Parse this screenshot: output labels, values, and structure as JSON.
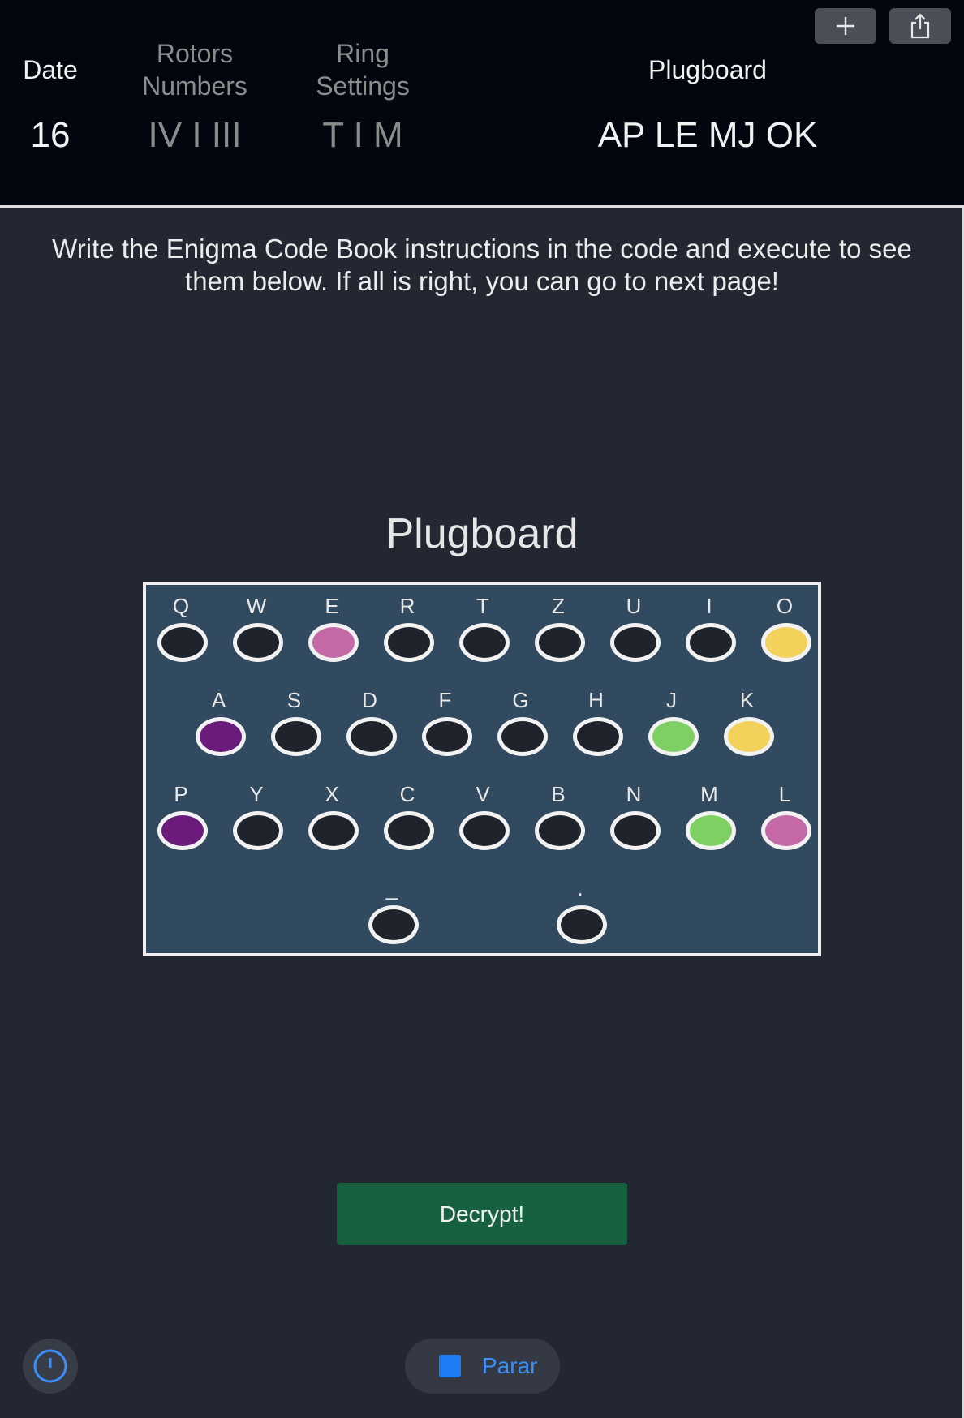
{
  "header": {
    "date_label": "Date",
    "rotors_label_line1": "Rotors",
    "rotors_label_line2": "Numbers",
    "ring_label_line1": "Ring",
    "ring_label_line2": "Settings",
    "plugboard_label": "Plugboard",
    "date_value": "16",
    "rotors_value": "IV I III",
    "ring_value": "T I M",
    "plugboard_value": "AP LE MJ OK"
  },
  "toolbar": {
    "add_icon": "plus-icon",
    "share_icon": "share-icon"
  },
  "instructions": "Write the Enigma Code Book instructions in the code and execute to see them below. If all is right, you can go to next page!",
  "plugboard": {
    "title": "Plugboard",
    "rows": [
      [
        {
          "letter": "Q",
          "color": "#1f232c"
        },
        {
          "letter": "W",
          "color": "#1f232c"
        },
        {
          "letter": "E",
          "color": "#c568a6"
        },
        {
          "letter": "R",
          "color": "#1f232c"
        },
        {
          "letter": "T",
          "color": "#1f232c"
        },
        {
          "letter": "Z",
          "color": "#1f232c"
        },
        {
          "letter": "U",
          "color": "#1f232c"
        },
        {
          "letter": "I",
          "color": "#1f232c"
        },
        {
          "letter": "O",
          "color": "#f3d25c"
        }
      ],
      [
        {
          "letter": "A",
          "color": "#6b1b7c"
        },
        {
          "letter": "S",
          "color": "#1f232c"
        },
        {
          "letter": "D",
          "color": "#1f232c"
        },
        {
          "letter": "F",
          "color": "#1f232c"
        },
        {
          "letter": "G",
          "color": "#1f232c"
        },
        {
          "letter": "H",
          "color": "#1f232c"
        },
        {
          "letter": "J",
          "color": "#7fd063"
        },
        {
          "letter": "K",
          "color": "#f3d25c"
        }
      ],
      [
        {
          "letter": "P",
          "color": "#6b1b7c"
        },
        {
          "letter": "Y",
          "color": "#1f232c"
        },
        {
          "letter": "X",
          "color": "#1f232c"
        },
        {
          "letter": "C",
          "color": "#1f232c"
        },
        {
          "letter": "V",
          "color": "#1f232c"
        },
        {
          "letter": "B",
          "color": "#1f232c"
        },
        {
          "letter": "N",
          "color": "#1f232c"
        },
        {
          "letter": "M",
          "color": "#7fd063"
        },
        {
          "letter": "L",
          "color": "#c568a6"
        }
      ],
      [
        {
          "letter": "_",
          "color": "#1f232c"
        },
        {
          "letter": ".",
          "color": "#1f232c"
        }
      ]
    ]
  },
  "decrypt_label": "Decrypt!",
  "bottom": {
    "gauge_icon": "gauge-icon",
    "stop_icon": "stop-icon",
    "stop_label": "Parar"
  }
}
